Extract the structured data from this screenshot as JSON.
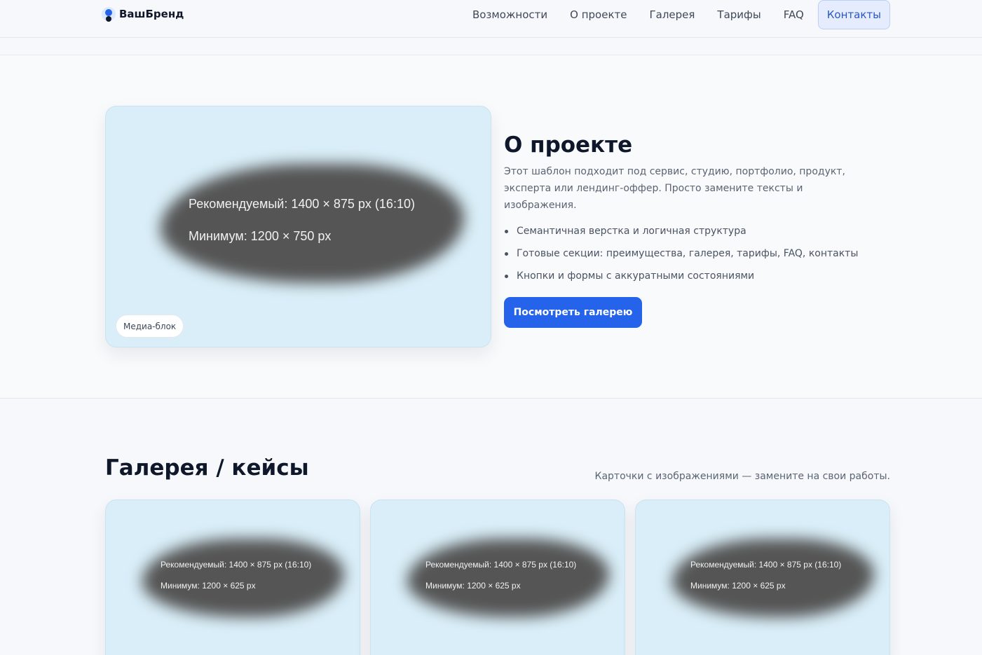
{
  "header": {
    "brand": "ВашБренд",
    "nav": [
      "Возможности",
      "О проекте",
      "Галерея",
      "Тарифы",
      "FAQ"
    ],
    "nav_active": "Контакты"
  },
  "about": {
    "title": "О проекте",
    "description": "Этот шаблон подходит под сервис, студию, портфолио, продукт, эксперта или лендинг-оффер. Просто замените тексты и изображения.",
    "features": [
      "Семантичная верстка и логичная структура",
      "Готовые секции: преимущества, галерея, тарифы, FAQ, контакты",
      "Кнопки и формы с аккуратными состояниями"
    ],
    "cta": "Посмотреть галерею",
    "media": {
      "badge": "Медиа-блок",
      "line1": "Рекомендуемый: 1400 × 875 px (16:10)",
      "line2": "Минимум: 1200 × 750 px"
    }
  },
  "gallery": {
    "title": "Галерея / кейсы",
    "subtitle": "Карточки с изображениями — замените на свои работы.",
    "cards": [
      {
        "line1": "Рекомендуемый: 1400 × 875 px (16:10)",
        "line2": "Минимум: 1200 × 625 px"
      },
      {
        "line1": "Рекомендуемый: 1400 × 875 px (16:10)",
        "line2": "Минимум: 1200 × 625 px"
      },
      {
        "line1": "Рекомендуемый: 1400 × 875 px (16:10)",
        "line2": "Минимум: 1200 × 625 px"
      }
    ]
  },
  "colors": {
    "accent": "#2563eb",
    "media_bg": "#d9eef8",
    "placeholder_blob": "#555555"
  }
}
